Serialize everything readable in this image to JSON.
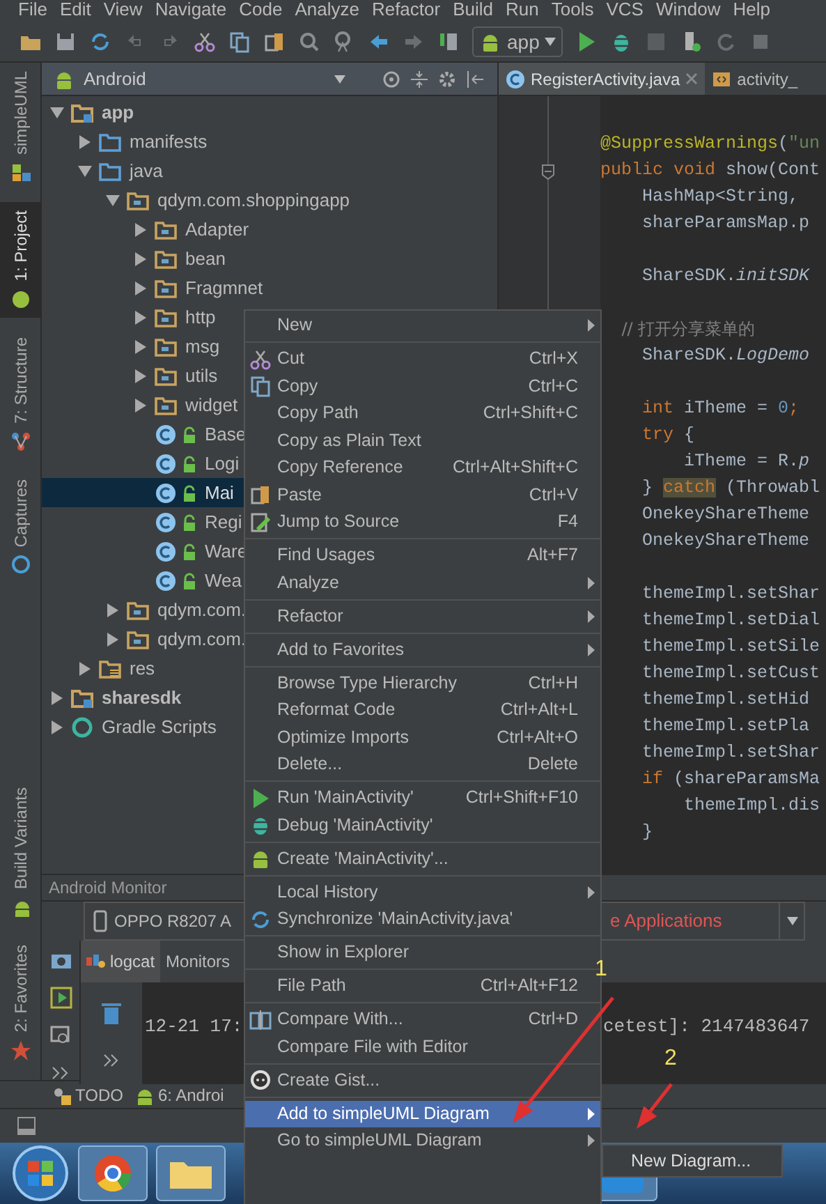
{
  "menu_bar": [
    "File",
    "Edit",
    "View",
    "Navigate",
    "Code",
    "Analyze",
    "Refactor",
    "Build",
    "Run",
    "Tools",
    "VCS",
    "Window",
    "Help"
  ],
  "toolbar": {
    "run_config": "app"
  },
  "tool_window_bar": {
    "top": [
      {
        "label": "simpleUML",
        "selected": false
      },
      {
        "label": "1: Project",
        "selected": true
      },
      {
        "label": "7: Structure",
        "selected": false
      },
      {
        "label": "Captures",
        "selected": false
      }
    ],
    "bottom": [
      {
        "label": "Build Variants",
        "selected": false
      },
      {
        "label": "2: Favorites",
        "selected": false
      }
    ]
  },
  "project_panel": {
    "view": "Android",
    "tree": [
      {
        "label": "app",
        "kind": "module",
        "expanded": true,
        "selected": false,
        "children": [
          {
            "label": "manifests",
            "kind": "folder",
            "expanded": false,
            "selected": false
          },
          {
            "label": "java",
            "kind": "folder",
            "expanded": true,
            "selected": false,
            "children": [
              {
                "label": "qdym.com.shoppingapp",
                "kind": "package",
                "expanded": true,
                "selected": false,
                "children": [
                  {
                    "label": "Adapter",
                    "kind": "package",
                    "expanded": false,
                    "selected": false
                  },
                  {
                    "label": "bean",
                    "kind": "package",
                    "expanded": false,
                    "selected": false
                  },
                  {
                    "label": "Fragmnet",
                    "kind": "package",
                    "expanded": false,
                    "selected": false
                  },
                  {
                    "label": "http",
                    "kind": "package",
                    "expanded": false,
                    "selected": false
                  },
                  {
                    "label": "msg",
                    "kind": "package",
                    "expanded": false,
                    "selected": false
                  },
                  {
                    "label": "utils",
                    "kind": "package",
                    "expanded": false,
                    "selected": false
                  },
                  {
                    "label": "widget",
                    "kind": "package",
                    "expanded": false,
                    "selected": false
                  },
                  {
                    "label": "Base",
                    "kind": "class",
                    "selected": false
                  },
                  {
                    "label": "Logi",
                    "kind": "class",
                    "selected": false
                  },
                  {
                    "label": "Mai",
                    "kind": "class",
                    "selected": true
                  },
                  {
                    "label": "Regi",
                    "kind": "class",
                    "selected": false
                  },
                  {
                    "label": "Ware",
                    "kind": "class",
                    "selected": false
                  },
                  {
                    "label": "Wea",
                    "kind": "class",
                    "selected": false
                  }
                ]
              },
              {
                "label": "qdym.com.",
                "kind": "package",
                "expanded": false,
                "selected": false
              },
              {
                "label": "qdym.com.",
                "kind": "package",
                "expanded": false,
                "selected": false
              }
            ]
          },
          {
            "label": "res",
            "kind": "res",
            "expanded": false,
            "selected": false
          }
        ]
      },
      {
        "label": "sharesdk",
        "kind": "module",
        "expanded": false,
        "selected": false
      },
      {
        "label": "Gradle Scripts",
        "kind": "gradle",
        "expanded": false,
        "selected": false
      }
    ]
  },
  "editor": {
    "tabs": [
      {
        "label": "RegisterActivity.java",
        "selected": true
      },
      {
        "label": "activity_",
        "selected": false
      }
    ],
    "lines": [
      {
        "segments": [
          {
            "text": "@SuppressWarnings",
            "kind": "annotation"
          },
          {
            "text": "(",
            "kind": "plain"
          },
          {
            "text": "\"un",
            "kind": "string"
          }
        ]
      },
      {
        "segments": [
          {
            "text": "public void",
            "kind": "keyword"
          },
          {
            "text": " show(Cont",
            "kind": "plain"
          }
        ]
      },
      {
        "segments": [
          {
            "text": "    HashMap<String, ",
            "kind": "plain"
          }
        ]
      },
      {
        "segments": [
          {
            "text": "    shareParamsMap.p",
            "kind": "plain"
          }
        ]
      },
      {
        "gap_before": true,
        "segments": [
          {
            "text": "    ShareSDK.",
            "kind": "plain"
          },
          {
            "text": "initSDK",
            "kind": "italic"
          }
        ]
      },
      {
        "gap_before": true,
        "segments": [
          {
            "text": "    // 打开分享菜单的",
            "kind": "comment"
          }
        ]
      },
      {
        "segments": [
          {
            "text": "    ShareSDK.",
            "kind": "plain"
          },
          {
            "text": "LogDemo",
            "kind": "italic"
          }
        ]
      },
      {
        "gap_before": true,
        "segments": [
          {
            "text": "    int",
            "kind": "keyword"
          },
          {
            "text": " iTheme = ",
            "kind": "plain"
          },
          {
            "text": "0",
            "kind": "number"
          },
          {
            "text": ";",
            "kind": "keyword"
          }
        ]
      },
      {
        "segments": [
          {
            "text": "    try",
            "kind": "keyword"
          },
          {
            "text": " {",
            "kind": "plain"
          }
        ]
      },
      {
        "segments": [
          {
            "text": "        iTheme = R.",
            "kind": "plain"
          },
          {
            "text": "p",
            "kind": "italic"
          }
        ]
      },
      {
        "segments": [
          {
            "text": "    } ",
            "kind": "plain"
          },
          {
            "text": "catch",
            "kind": "keyword_highlight"
          },
          {
            "text": " (Throwabl",
            "kind": "plain"
          }
        ]
      },
      {
        "segments": [
          {
            "text": "    OnekeyShareTheme",
            "kind": "plain"
          }
        ]
      },
      {
        "segments": [
          {
            "text": "    OnekeyShareTheme",
            "kind": "plain"
          }
        ]
      },
      {
        "gap_before": true,
        "segments": [
          {
            "text": "    themeImpl.setShar",
            "kind": "plain"
          }
        ]
      },
      {
        "segments": [
          {
            "text": "    themeImpl.setDial",
            "kind": "plain"
          }
        ]
      },
      {
        "segments": [
          {
            "text": "    themeImpl.setSile",
            "kind": "plain"
          }
        ]
      },
      {
        "segments": [
          {
            "text": "    themeImpl.setCust",
            "kind": "plain"
          }
        ]
      },
      {
        "segments": [
          {
            "text": "    themeImpl.setHid",
            "kind": "plain"
          }
        ]
      },
      {
        "segments": [
          {
            "text": "    themeImpl.setPla",
            "kind": "plain"
          }
        ]
      },
      {
        "segments": [
          {
            "text": "    themeImpl.setShar",
            "kind": "plain"
          }
        ]
      },
      {
        "segments": [
          {
            "text": "    if",
            "kind": "keyword"
          },
          {
            "text": " (shareParamsMa",
            "kind": "plain"
          }
        ]
      },
      {
        "segments": [
          {
            "text": "        themeImpl.dis",
            "kind": "plain"
          }
        ]
      },
      {
        "segments": [
          {
            "text": "    }",
            "kind": "plain"
          }
        ]
      }
    ]
  },
  "android_monitor": {
    "title": "Android Monitor",
    "device": "OPPO R8207 A",
    "process": "e Applications",
    "tabs": [
      {
        "label": "logcat",
        "selected": true
      },
      {
        "label": "Monitors",
        "selected": false
      }
    ],
    "log": [
      {
        "time": "12-21 17:",
        "message": "cetest]: 2147483647"
      }
    ]
  },
  "bottom_tabs": [
    {
      "label": "TODO"
    },
    {
      "label": "6: Androi"
    }
  ],
  "context_menu": {
    "groups": [
      {
        "items": [
          {
            "label": "New",
            "has_submenu": true,
            "selected": false
          }
        ]
      },
      {
        "items": [
          {
            "label": "Cut",
            "shortcut": "Ctrl+X",
            "has_submenu": false,
            "selected": false
          },
          {
            "label": "Copy",
            "shortcut": "Ctrl+C",
            "has_submenu": false,
            "selected": false
          },
          {
            "label": "Copy Path",
            "shortcut": "Ctrl+Shift+C",
            "has_submenu": false,
            "selected": false
          },
          {
            "label": "Copy as Plain Text",
            "has_submenu": false,
            "selected": false
          },
          {
            "label": "Copy Reference",
            "shortcut": "Ctrl+Alt+Shift+C",
            "has_submenu": false,
            "selected": false
          },
          {
            "label": "Paste",
            "shortcut": "Ctrl+V",
            "has_submenu": false,
            "selected": false
          },
          {
            "label": "Jump to Source",
            "shortcut": "F4",
            "has_submenu": false,
            "selected": false
          }
        ]
      },
      {
        "items": [
          {
            "label": "Find Usages",
            "shortcut": "Alt+F7",
            "has_submenu": false,
            "selected": false
          },
          {
            "label": "Analyze",
            "has_submenu": true,
            "selected": false
          }
        ]
      },
      {
        "items": [
          {
            "label": "Refactor",
            "has_submenu": true,
            "selected": false
          }
        ]
      },
      {
        "items": [
          {
            "label": "Add to Favorites",
            "has_submenu": true,
            "selected": false
          }
        ]
      },
      {
        "items": [
          {
            "label": "Browse Type Hierarchy",
            "shortcut": "Ctrl+H",
            "has_submenu": false,
            "selected": false
          },
          {
            "label": "Reformat Code",
            "shortcut": "Ctrl+Alt+L",
            "has_submenu": false,
            "selected": false
          },
          {
            "label": "Optimize Imports",
            "shortcut": "Ctrl+Alt+O",
            "has_submenu": false,
            "selected": false
          },
          {
            "label": "Delete...",
            "shortcut": "Delete",
            "has_submenu": false,
            "selected": false
          }
        ]
      },
      {
        "items": [
          {
            "label": "Run 'MainActivity'",
            "shortcut": "Ctrl+Shift+F10",
            "has_submenu": false,
            "selected": false
          },
          {
            "label": "Debug 'MainActivity'",
            "has_submenu": false,
            "selected": false
          }
        ]
      },
      {
        "items": [
          {
            "label": "Create 'MainActivity'...",
            "has_submenu": false,
            "selected": false
          }
        ]
      },
      {
        "items": [
          {
            "label": "Local History",
            "has_submenu": true,
            "selected": false
          },
          {
            "label": "Synchronize 'MainActivity.java'",
            "has_submenu": false,
            "selected": false
          }
        ]
      },
      {
        "items": [
          {
            "label": "Show in Explorer",
            "has_submenu": false,
            "selected": false
          }
        ]
      },
      {
        "items": [
          {
            "label": "File Path",
            "shortcut": "Ctrl+Alt+F12",
            "has_submenu": false,
            "selected": false
          }
        ]
      },
      {
        "items": [
          {
            "label": "Compare With...",
            "shortcut": "Ctrl+D",
            "has_submenu": false,
            "selected": false
          },
          {
            "label": "Compare File with Editor",
            "has_submenu": false,
            "selected": false
          }
        ]
      },
      {
        "items": [
          {
            "label": "Create Gist...",
            "has_submenu": false,
            "selected": false
          }
        ]
      },
      {
        "items": [
          {
            "label": "Add to simpleUML Diagram",
            "has_submenu": true,
            "selected": true
          },
          {
            "label": "Go to simpleUML Diagram",
            "has_submenu": true,
            "selected": false
          }
        ]
      }
    ]
  },
  "submenu": {
    "items": [
      {
        "label": "New Diagram..."
      }
    ]
  },
  "annotations": [
    {
      "label": "1"
    },
    {
      "label": "2"
    }
  ]
}
